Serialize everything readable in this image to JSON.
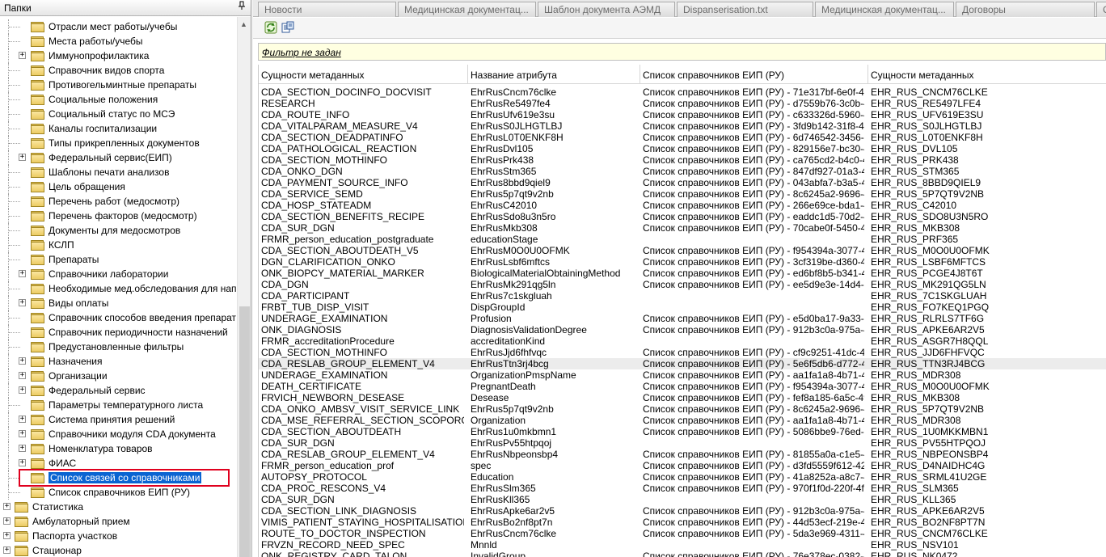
{
  "left_panel": {
    "title": "Папки",
    "pin_glyph": "ᵖ",
    "tree_items": [
      {
        "label": "Отрасли мест работы/учебы",
        "expandable": false,
        "level": 1
      },
      {
        "label": "Места работы/учебы",
        "expandable": false,
        "level": 1
      },
      {
        "label": "Иммунопрофилактика",
        "expandable": true,
        "level": 1
      },
      {
        "label": "Справочник видов спорта",
        "expandable": false,
        "level": 1
      },
      {
        "label": "Противогельминтные препараты",
        "expandable": false,
        "level": 1
      },
      {
        "label": "Социальные положения",
        "expandable": false,
        "level": 1
      },
      {
        "label": "Социальный статус по МСЭ",
        "expandable": false,
        "level": 1
      },
      {
        "label": "Каналы госпитализации",
        "expandable": false,
        "level": 1
      },
      {
        "label": "Типы прикрепленных документов",
        "expandable": false,
        "level": 1
      },
      {
        "label": "Федеральный сервис(ЕИП)",
        "expandable": true,
        "level": 1
      },
      {
        "label": "Шаблоны печати анализов",
        "expandable": false,
        "level": 1
      },
      {
        "label": "Цель обращения",
        "expandable": false,
        "level": 1
      },
      {
        "label": "Перечень работ (медосмотр)",
        "expandable": false,
        "level": 1
      },
      {
        "label": "Перечень факторов (медосмотр)",
        "expandable": false,
        "level": 1
      },
      {
        "label": "Документы для медосмотров",
        "expandable": false,
        "level": 1
      },
      {
        "label": "КСЛП",
        "expandable": false,
        "level": 1
      },
      {
        "label": "Препараты",
        "expandable": false,
        "level": 1
      },
      {
        "label": "Справочники лаборатории",
        "expandable": true,
        "level": 1
      },
      {
        "label": "Необходимые мед.обследования для напр",
        "expandable": false,
        "level": 1
      },
      {
        "label": "Виды оплаты",
        "expandable": true,
        "level": 1
      },
      {
        "label": "Справочник способов введения препарат",
        "expandable": false,
        "level": 1
      },
      {
        "label": "Справочник периодичности назначений",
        "expandable": false,
        "level": 1
      },
      {
        "label": "Предустановленные фильтры",
        "expandable": false,
        "level": 1
      },
      {
        "label": "Назначения",
        "expandable": true,
        "level": 1
      },
      {
        "label": "Организации",
        "expandable": true,
        "level": 1
      },
      {
        "label": "Федеральный сервис",
        "expandable": true,
        "level": 1
      },
      {
        "label": "Параметры температурного листа",
        "expandable": false,
        "level": 1
      },
      {
        "label": "Система принятия решений",
        "expandable": true,
        "level": 1
      },
      {
        "label": "Справочники модуля CDA документа",
        "expandable": true,
        "level": 1
      },
      {
        "label": "Номенклатура товаров",
        "expandable": true,
        "level": 1
      },
      {
        "label": "ФИАС",
        "expandable": true,
        "level": 1
      },
      {
        "label": "Список связей со справочниками",
        "expandable": false,
        "level": 1,
        "selected": true
      },
      {
        "label": "Список справочников ЕИП (РУ)",
        "expandable": false,
        "level": 1
      },
      {
        "label": "Статистика",
        "expandable": true,
        "level": 0
      },
      {
        "label": "Амбулаторный прием",
        "expandable": true,
        "level": 0
      },
      {
        "label": "Паспорта участков",
        "expandable": true,
        "level": 0
      },
      {
        "label": "Стационар",
        "expandable": true,
        "level": 0
      }
    ]
  },
  "tabs": [
    "Новости",
    "Медицинская  документац...",
    "Шаблон документа АЭМД",
    "Dispanserisation.txt",
    "Медицинская  документац...",
    "Договоры",
    "С"
  ],
  "filter": {
    "text": "Фильтр не задан"
  },
  "grid": {
    "columns": [
      "Сущности метаданных",
      "Название атрибута",
      "Список справочников ЕИП (РУ)",
      "Сущности метаданных"
    ],
    "rows": [
      [
        "CDA_SECTION_DOCINFO_DOCVISIT",
        "EhrRusCncm76clke",
        "Список справочников ЕИП (РУ) - 71e317bf-6e0f-4c...",
        "EHR_RUS_CNCM76CLKE"
      ],
      [
        "RESEARCH",
        "EhrRusRe5497fe4",
        "Список справочников ЕИП (РУ) - d7559b76-3c0b-4...",
        "EHR_RUS_RE5497LFE4"
      ],
      [
        "CDA_ROUTE_INFO",
        "EhrRusUfv619e3su",
        "Список справочников ЕИП (РУ) - c633326d-5960-4...",
        "EHR_RUS_UFV619E3SU"
      ],
      [
        "CDA_VITALPARAM_MEASURE_V4",
        "EhrRusS0JLHGTLBJ",
        "Список справочников ЕИП (РУ) - 3fd9b142-31f8-4b...",
        "EHR_RUS_S0JLHGTLBJ"
      ],
      [
        "CDA_SECTION_DEADPATINFO",
        "EhrRusL0T0ENKF8H",
        "Список справочников ЕИП (РУ) - 6d746542-3456-4...",
        "EHR_RUS_L0T0ENKF8H"
      ],
      [
        "CDA_PATHOLOGICAL_REACTION",
        "EhrRusDvl105",
        "Список справочников ЕИП (РУ) - 829156e7-bc30-4...",
        "EHR_RUS_DVL105"
      ],
      [
        "CDA_SECTION_MOTHINFO",
        "EhrRusPrk438",
        "Список справочников ЕИП (РУ) - ca765cd2-b4c0-4...",
        "EHR_RUS_PRK438"
      ],
      [
        "CDA_ONKO_DGN",
        "EhrRusStm365",
        "Список справочников ЕИП (РУ) - 847df927-01a3-47...",
        "EHR_RUS_STM365"
      ],
      [
        "CDA_PAYMENT_SOURCE_INFO",
        "EhrRus8bbd9qiel9",
        "Список справочников ЕИП (РУ) - 043abfa7-b3a5-47...",
        "EHR_RUS_8BBD9QIEL9"
      ],
      [
        "CDA_SERVICE_SEMD",
        "EhrRus5p7qt9v2nb",
        "Список справочников ЕИП (РУ) - 8c6245a2-9696-4...",
        "EHR_RUS_5P7QT9V2NB"
      ],
      [
        "CDA_HOSP_STATEADM",
        "EhrRusC42010",
        "Список справочников ЕИП (РУ) - 266e69ce-bda1-4...",
        "EHR_RUS_C42010"
      ],
      [
        "CDA_SECTION_BENEFITS_RECIPE",
        "EhrRusSdo8u3n5ro",
        "Список справочников ЕИП (РУ) - eaddc1d5-70d2-4...",
        "EHR_RUS_SDO8U3N5RO"
      ],
      [
        "CDA_SUR_DGN",
        "EhrRusMkb308",
        "Список справочников ЕИП (РУ) - 70cabe0f-5450-45...",
        "EHR_RUS_MKB308"
      ],
      [
        "FRMR_person_education_postgraduate",
        "educationStage",
        "",
        "EHR_RUS_PRF365"
      ],
      [
        "CDA_SECTION_ABOUTDEATH_V5",
        "EhrRusM0O0U0OFMK",
        "Список справочников ЕИП (РУ) - f954394a-3077-49...",
        "EHR_RUS_M0O0U0OFMK"
      ],
      [
        "DGN_CLARIFICATION_ONKO",
        "EhrRusLsbf6mftcs",
        "Список справочников ЕИП (РУ) - 3cf319be-d360-4b...",
        "EHR_RUS_LSBF6MFTCS"
      ],
      [
        "ONK_BIOPCY_MATERIAL_MARKER",
        "BiologicalMaterialObtainingMethod",
        "Список справочников ЕИП (РУ) - ed6bf8b5-b341-48...",
        "EHR_RUS_PCGE4J8T6T"
      ],
      [
        "CDA_DGN",
        "EhrRusMk291qg5ln",
        "Список справочников ЕИП (РУ) - ee5d9e3e-14d4-4...",
        "EHR_RUS_MK291QG5LN"
      ],
      [
        "CDA_PARTICIPANT",
        "EhrRus7c1skgluah",
        "",
        "EHR_RUS_7C1SKGLUAH"
      ],
      [
        "FRBT_TUB_DISP_VISIT",
        "DispGroupId",
        "",
        "EHR_RUS_FO7KEQ1PGQ"
      ],
      [
        "UNDERAGE_EXAMINATION",
        "Profusion",
        "Список справочников ЕИП (РУ) - e5d0ba17-9a33-4...",
        "EHR_RUS_RLRLS7TF6G"
      ],
      [
        "ONK_DIAGNOSIS",
        "DiagnosisValidationDegree",
        "Список справочников ЕИП (РУ) - 912b3c0a-975a-4...",
        "EHR_RUS_APKE6AR2V5"
      ],
      [
        "FRMR_accreditationProcedure",
        "accreditationKind",
        "",
        "EHR_RUS_ASGR7H8QQL"
      ],
      [
        "CDA_SECTION_MOTHINFO",
        "EhrRusJjd6fhfvqc",
        "Список справочников ЕИП (РУ) - cf9c9251-41dc-40...",
        "EHR_RUS_JJD6FHFVQC"
      ],
      [
        "CDA_RESLAB_GROUP_ELEMENT_V4",
        "EhrRusTtn3rj4bcg",
        "Список справочников ЕИП (РУ) - 5e6f5db6-d772-40...",
        "EHR_RUS_TTN3RJ4BCG"
      ],
      [
        "UNDERAGE_EXAMINATION",
        "OrganizationPmspName",
        "Список справочников ЕИП (РУ) - aa1fa1a8-4b71-44...",
        "EHR_RUS_MDR308"
      ],
      [
        "DEATH_CERTIFICATE",
        "PregnantDeath",
        "Список справочников ЕИП (РУ) - f954394a-3077-49...",
        "EHR_RUS_M0O0U0OFMK"
      ],
      [
        "FRVICH_NEWBORN_DESEASE",
        "Desease",
        "Список справочников ЕИП (РУ) - fef8a185-6a5c-49...",
        "EHR_RUS_MKB308"
      ],
      [
        "CDA_ONKO_AMBSV_VISIT_SERVICE_LINK",
        "EhrRus5p7qt9v2nb",
        "Список справочников ЕИП (РУ) - 8c6245a2-9696-4...",
        "EHR_RUS_5P7QT9V2NB"
      ],
      [
        "CDA_MSE_REFERRAL_SECTION_SCOPORG",
        "Organization",
        "Список справочников ЕИП (РУ) - aa1fa1a8-4b71-44...",
        "EHR_RUS_MDR308"
      ],
      [
        "CDA_SECTION_ABOUTDEATH",
        "EhrRus1u0mkbmn1",
        "Список справочников ЕИП (РУ) - 5086bbe9-76ed-4...",
        "EHR_RUS_1U0MKKMBN1"
      ],
      [
        "CDA_SUR_DGN",
        "EhrRusPv55htpqoj",
        "",
        "EHR_RUS_PV55HTPQOJ"
      ],
      [
        "CDA_RESLAB_GROUP_ELEMENT_V4",
        "EhrRusNbpeonsbp4",
        "Список справочников ЕИП (РУ) - 81855a0a-c1e5-4...",
        "EHR_RUS_NBPEONSBP4"
      ],
      [
        "FRMR_person_education_prof",
        "spec",
        "Список справочников ЕИП (РУ) - d3fd5559f612-42...",
        "EHR_RUS_D4NAIDHC4G"
      ],
      [
        "AUTOPSY_PROTOCOL",
        "Education",
        "Список справочников ЕИП (РУ) - 41a8252a-a8c7-4...",
        "EHR_RUS_SRML41U2GE"
      ],
      [
        "CDA_PROC_RESCONS_V4",
        "EhrRusSlm365",
        "Список справочников ЕИП (РУ) - 970f1f0d-220f-4f1f...",
        "EHR_RUS_SLM365"
      ],
      [
        "CDA_SUR_DGN",
        "EhrRusKll365",
        "",
        "EHR_RUS_KLL365"
      ],
      [
        "CDA_SECTION_LINK_DIAGNOSIS",
        "EhrRusApke6ar2v5",
        "Список справочников ЕИП (РУ) - 912b3c0a-975a-4...",
        "EHR_RUS_APKE6AR2V5"
      ],
      [
        "VIMIS_PATIENT_STAYING_HOSPITALISATION",
        "EhrRusBo2nf8pt7n",
        "Список справочников ЕИП (РУ) - 44d53ecf-219e-4b...",
        "EHR_RUS_BO2NF8PT7N"
      ],
      [
        "ROUTE_TO_DOCTOR_INSPECTION",
        "EhrRusCncm76clke",
        "Список справочников ЕИП (РУ) - 5da3e969-4311-4...",
        "EHR_RUS_CNCM76CLKE"
      ],
      [
        "FRVZN_RECORD_NEED_SPEC",
        "Mnnld",
        "",
        "EHR_RUS_NSV101"
      ],
      [
        "ONK_REGISTRY_CARD_TALON",
        "InvalidGroup",
        "Список справочников ЕИП (РУ) - 76e378ec-0382-4...",
        "EHR_RUS_NK0472"
      ]
    ],
    "highlight_row": 24
  }
}
